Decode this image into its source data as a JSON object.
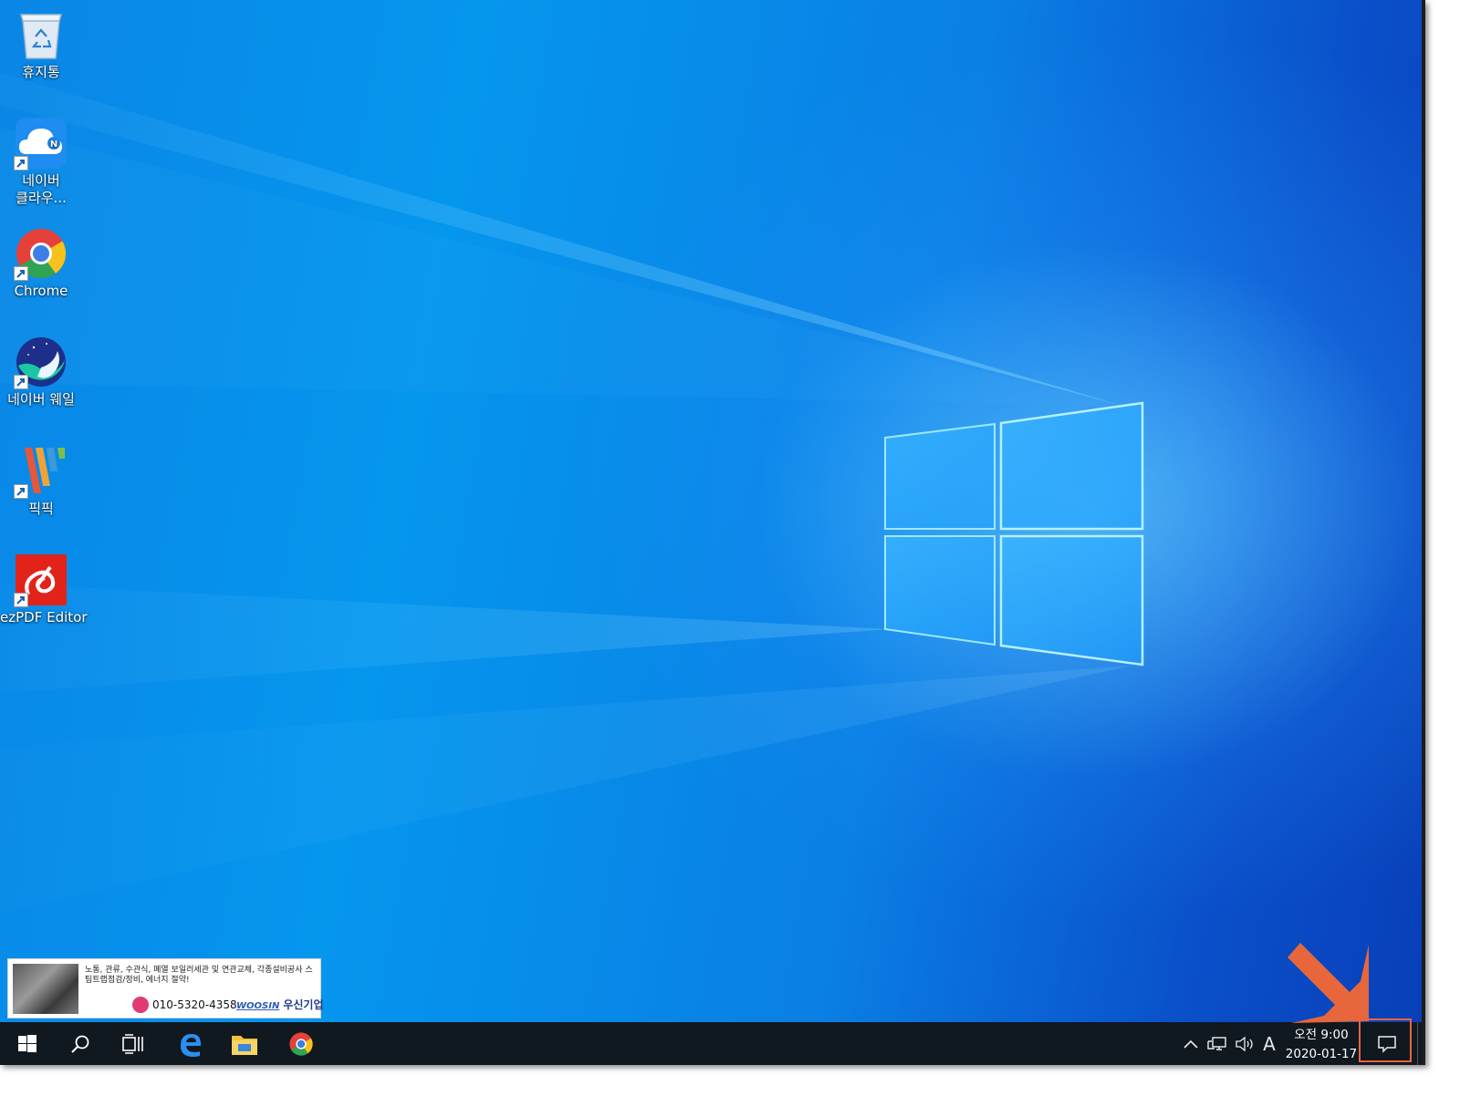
{
  "desktop": {
    "icons": [
      {
        "label": "휴지통",
        "icon": "recycle-bin-icon"
      },
      {
        "label": "네이버\n클라우...",
        "icon": "naver-cloud-icon"
      },
      {
        "label": "Chrome",
        "icon": "chrome-icon"
      },
      {
        "label": "네이버 웨일",
        "icon": "naver-whale-icon"
      },
      {
        "label": "픽픽",
        "icon": "picpick-icon"
      },
      {
        "label": "ezPDF Editor",
        "icon": "ezpdf-icon"
      }
    ]
  },
  "ad": {
    "text": "노통, 관류, 수관식, 폐열 보일러세관 및 연관교체, 각종설비공사 스팀트랩점검/정비, 에너지 절약!",
    "phone": "010-5320-4358",
    "brand_en": "WOOSIN",
    "brand_ko": "우신기업"
  },
  "taskbar": {
    "pinned": [
      "start-icon",
      "search-icon",
      "task-view-icon",
      "edge-icon",
      "file-explorer-icon",
      "chrome-icon"
    ],
    "tray": {
      "input_indicator": "A",
      "time": "오전 9:00",
      "date": "2020-01-17"
    }
  },
  "colors": {
    "taskbar": "#101820",
    "highlight": "#e8663c",
    "wallpaper_blue": "#0a86e6"
  }
}
